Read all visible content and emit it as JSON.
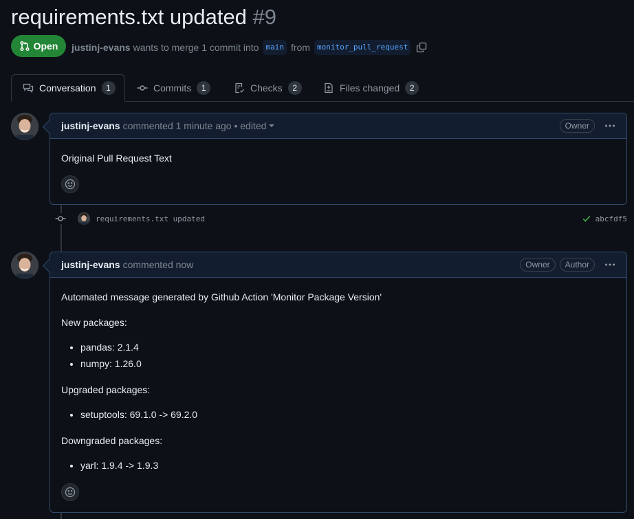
{
  "pr": {
    "title": "requirements.txt updated",
    "number": "#9",
    "state": "Open",
    "author": "justinj-evans",
    "merge_text": "wants to merge 1 commit into",
    "base_branch": "main",
    "from_text": "from",
    "head_branch": "monitor_pull_request"
  },
  "tabs": [
    {
      "label": "Conversation",
      "count": "1"
    },
    {
      "label": "Commits",
      "count": "1"
    },
    {
      "label": "Checks",
      "count": "2"
    },
    {
      "label": "Files changed",
      "count": "2"
    }
  ],
  "comment1": {
    "author": "justinj-evans",
    "meta": "commented 1 minute ago • edited",
    "role": "Owner",
    "body": "Original Pull Request Text"
  },
  "commit": {
    "message": "requirements.txt updated",
    "sha": "abcfdf5"
  },
  "comment2": {
    "author": "justinj-evans",
    "meta": "commented now",
    "roles": [
      "Owner",
      "Author"
    ],
    "intro": "Automated message generated by Github Action 'Monitor Package Version'",
    "new_heading": "New packages:",
    "new_items": [
      "pandas: 2.1.4",
      "numpy: 1.26.0"
    ],
    "upgraded_heading": "Upgraded packages:",
    "upgraded_items": [
      "setuptools: 69.1.0 -> 69.2.0"
    ],
    "downgraded_heading": "Downgraded packages:",
    "downgraded_items": [
      "yarl: 1.9.4 -> 1.9.3"
    ]
  },
  "colors": {
    "open_green": "#238636",
    "link_blue": "#58a6ff",
    "success_green": "#3fb950"
  }
}
